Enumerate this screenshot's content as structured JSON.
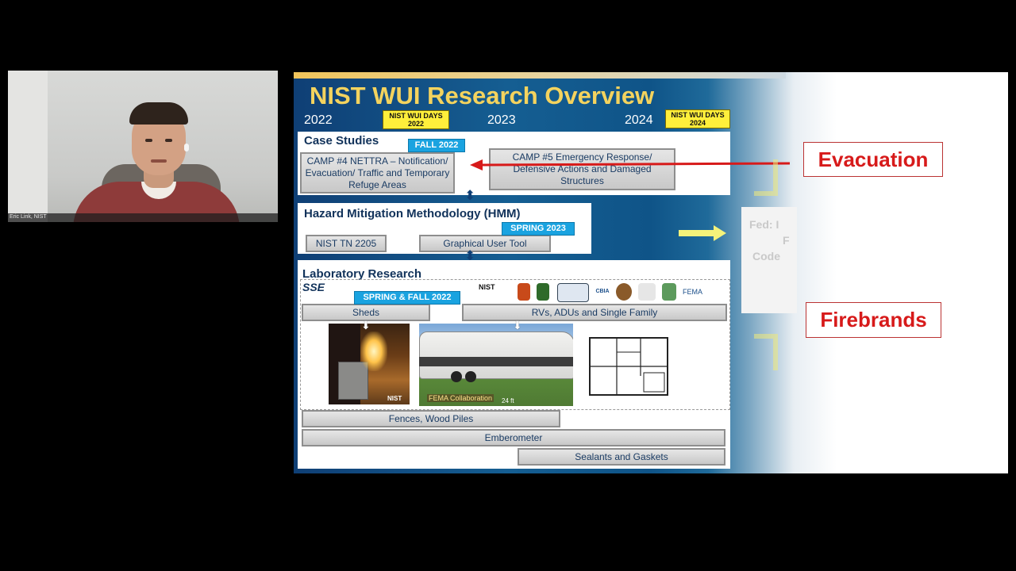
{
  "webcam": {
    "name_label": "Eric Link, NIST"
  },
  "slide": {
    "title": "NIST WUI Research Overview",
    "years": [
      "2022",
      "2023",
      "2024"
    ],
    "wui_days_2022": "NIST WUI DAYS 2022",
    "wui_days_2024": "NIST WUI DAYS 2024",
    "case_studies": {
      "heading": "Case Studies",
      "badge": "FALL 2022",
      "camp4": "CAMP #4 NETTRA – Notification/ Evacuation/ Traffic and Temporary Refuge Areas",
      "camp5": "CAMP #5 Emergency Response/ Defensive Actions and Damaged Structures"
    },
    "hmm": {
      "heading": "Hazard Mitigation Methodology (HMM)",
      "badge": "SPRING 2023",
      "tn": "NIST TN 2205",
      "gui": "Graphical User Tool"
    },
    "lab": {
      "heading": "Laboratory Research",
      "sse": "SSE",
      "badge": "SPRING & FALL 2022",
      "sheds": "Sheds",
      "rvs": "RVs, ADUs and Single Family",
      "fema_collab": "FEMA Collaboration",
      "length": "24 ft",
      "fences": "Fences, Wood Piles",
      "emberometer": "Emberometer",
      "sealants": "Sealants and Gaskets",
      "nist_logo_text": "NIST",
      "cbia_logo_text": "CBIA",
      "fema_logo_text": "FEMA",
      "nist_mark": "NIST"
    },
    "callouts": {
      "evacuation": "Evacuation",
      "firebrands": "Firebrands"
    },
    "partial_box": {
      "line1": "Fed: I",
      "line2": "F",
      "line3": "Code"
    }
  }
}
